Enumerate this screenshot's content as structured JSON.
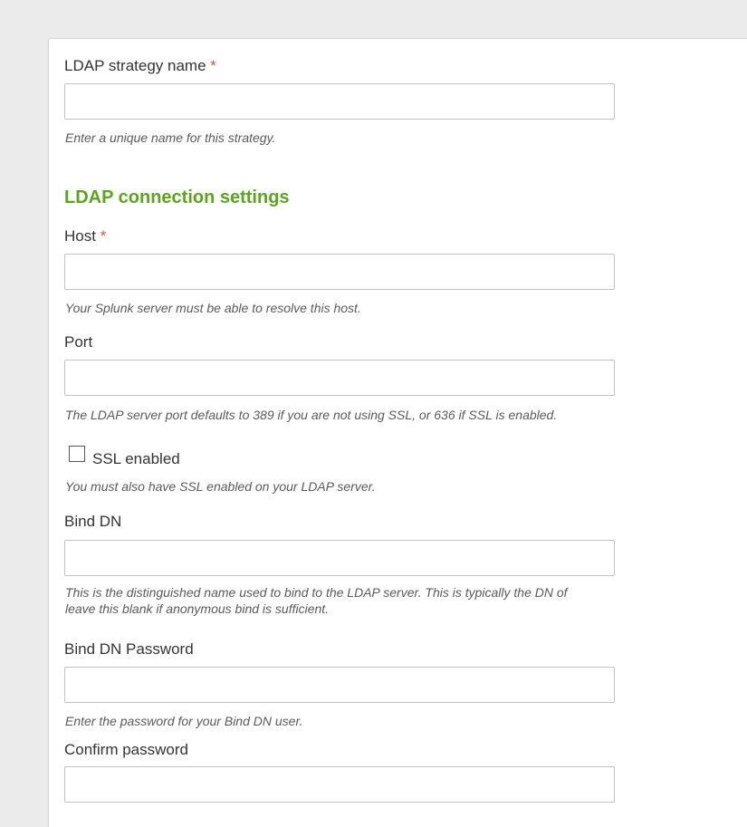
{
  "form": {
    "strategy_name": {
      "label": "LDAP strategy name",
      "required_marker": "*",
      "value": "",
      "help": "Enter a unique name for this strategy."
    },
    "connection_section_title": "LDAP connection settings",
    "host": {
      "label": "Host",
      "required_marker": "*",
      "value": "",
      "help": "Your Splunk server must be able to resolve this host."
    },
    "port": {
      "label": "Port",
      "value": "",
      "help": "The LDAP server port defaults to 389 if you are not using SSL, or 636 if SSL is enabled."
    },
    "ssl": {
      "label": "SSL enabled",
      "checked": false,
      "help": "You must also have SSL enabled on your LDAP server."
    },
    "bind_dn": {
      "label": "Bind DN",
      "value": "",
      "help_line1": "This is the distinguished name used to bind to the LDAP server. This is typically the DN of",
      "help_line2": "leave this blank if anonymous bind is sufficient."
    },
    "bind_dn_password": {
      "label": "Bind DN Password",
      "value": "",
      "help": "Enter the password for your Bind DN user."
    },
    "confirm_password": {
      "label": "Confirm password",
      "value": ""
    }
  },
  "colors": {
    "section_title": "#5ba51e",
    "required_marker": "#d6563c",
    "background": "#ebebeb"
  }
}
